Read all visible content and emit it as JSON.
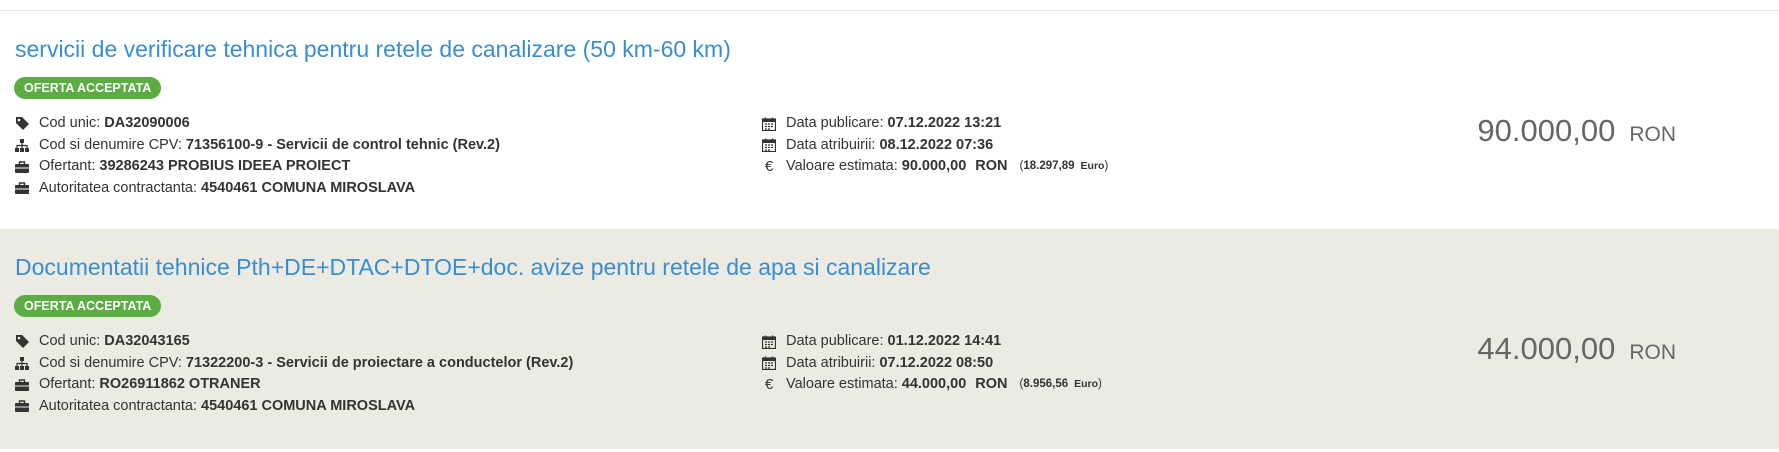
{
  "results": [
    {
      "title": "servicii de verificare tehnica pentru retele de canalizare (50 km-60 km)",
      "status": "OFERTA ACCEPTATA",
      "cod_unic_label": "Cod unic:",
      "cod_unic": "DA32090006",
      "cpv_label": "Cod si denumire CPV:",
      "cpv": "71356100-9 - Servicii de control tehnic (Rev.2)",
      "ofertant_label": "Ofertant:",
      "ofertant": "39286243 PROBIUS IDEEA PROIECT",
      "autoritate_label": "Autoritatea contractanta:",
      "autoritate": "4540461 COMUNA MIROSLAVA",
      "data_publicare_label": "Data publicare:",
      "data_publicare": "07.12.2022 13:21",
      "data_atribuirii_label": "Data atribuirii:",
      "data_atribuirii": "08.12.2022 07:36",
      "valoare_label": "Valoare estimata:",
      "valoare": "90.000,00",
      "valoare_currency": "RON",
      "valoare_euro_open": "(",
      "valoare_euro": "18.297,89",
      "valoare_euro_unit": "Euro",
      "valoare_euro_close": ")",
      "amount": "90.000,00",
      "amount_currency": "RON"
    },
    {
      "title": "Documentatii tehnice Pth+DE+DTAC+DTOE+doc. avize pentru retele de apa si canalizare",
      "status": "OFERTA ACCEPTATA",
      "cod_unic_label": "Cod unic:",
      "cod_unic": "DA32043165",
      "cpv_label": "Cod si denumire CPV:",
      "cpv": "71322200-3 - Servicii de proiectare a conductelor (Rev.2)",
      "ofertant_label": "Ofertant:",
      "ofertant": "RO26911862 OTRANER",
      "autoritate_label": "Autoritatea contractanta:",
      "autoritate": "4540461 COMUNA MIROSLAVA",
      "data_publicare_label": "Data publicare:",
      "data_publicare": "01.12.2022 14:41",
      "data_atribuirii_label": "Data atribuirii:",
      "data_atribuirii": "07.12.2022 08:50",
      "valoare_label": "Valoare estimata:",
      "valoare": "44.000,00",
      "valoare_currency": "RON",
      "valoare_euro_open": "(",
      "valoare_euro": "8.956,56",
      "valoare_euro_unit": "Euro",
      "valoare_euro_close": ")",
      "amount": "44.000,00",
      "amount_currency": "RON"
    }
  ],
  "icons": {
    "cod_unic": "tag-icon",
    "cpv": "sitemap-icon",
    "ofertant": "briefcase-icon",
    "autoritate": "briefcase-icon",
    "data_publicare": "calendar-icon",
    "data_atribuirii": "calendar-icon",
    "valoare": "euro-icon"
  },
  "euro_symbol": "€",
  "colors": {
    "title": "#3a8ecf",
    "badge": "#5aac43",
    "alt_row_bg": "#ecebe3",
    "amount_text": "#666666"
  }
}
